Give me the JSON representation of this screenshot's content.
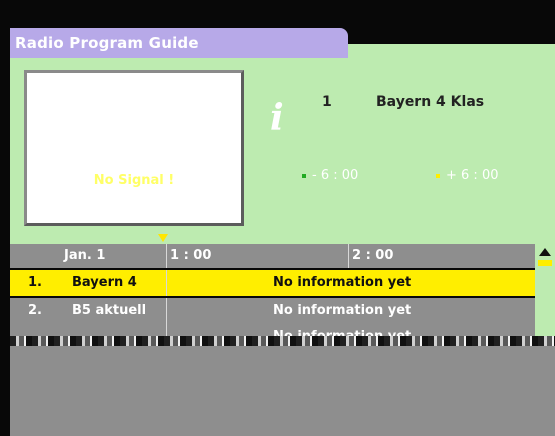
{
  "window": {
    "title": "Radio Program Guide"
  },
  "preview": {
    "status_text": "No Signal !"
  },
  "channel_info": {
    "icon": "info-icon",
    "number": "1",
    "name": "Bayern 4 Klas"
  },
  "time_shift": {
    "back_label": "- 6 : 00",
    "forward_label": "+ 6 : 00",
    "back_color": "#22aa22",
    "forward_color": "#ffee00"
  },
  "timeline": {
    "date": "Jan. 1",
    "slots": [
      "1 : 00",
      "2 : 00"
    ]
  },
  "rows": [
    {
      "num": "1.",
      "name": "Bayern 4",
      "info": "No information yet",
      "selected": true
    },
    {
      "num": "2.",
      "name": "B5 aktuell",
      "info": "No information yet",
      "selected": false
    },
    {
      "num": "",
      "name": "",
      "info": "No information yet",
      "selected": false
    }
  ],
  "colors": {
    "panel": "#bdebb0",
    "title_tab": "#b7a9e8",
    "selected_row": "#ffee00",
    "row": "#8e8e8e"
  }
}
